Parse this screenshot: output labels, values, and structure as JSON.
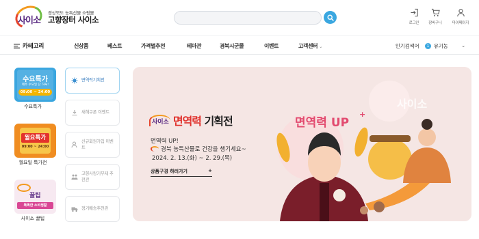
{
  "header": {
    "logo_sub": "경상북도 농특산물 쇼핑몰",
    "logo_main": "고향장터 사이소",
    "logo_word": "사이소",
    "search_placeholder": "",
    "utils": [
      {
        "label": "로그인",
        "icon": "login-icon"
      },
      {
        "label": "장바구니",
        "icon": "cart-icon"
      },
      {
        "label": "마이페이지",
        "icon": "user-icon"
      }
    ]
  },
  "nav": {
    "category_label": "카테고리",
    "items": [
      "신상품",
      "베스트",
      "가격별추천",
      "테마관",
      "경북시군몰",
      "이벤트",
      "고객센터"
    ],
    "popular_label": "인기검색어",
    "popular_rank": "1",
    "popular_term": "유기농"
  },
  "left_promos": [
    {
      "label": "수요특가",
      "badge_title": "수요특가",
      "badge_sub": "매주 수요일 단 하루!",
      "badge_time": "09:00 ~ 24:00"
    },
    {
      "label": "월요일 특가전",
      "badge_title": "월요특가",
      "badge_time": "09:00 ~ 24:00"
    },
    {
      "label": "사이소 꿀팁",
      "badge_title": "꿀팁",
      "badge_sub": "똑똑한 소비생활"
    }
  ],
  "tabs": [
    {
      "label": "면역력기획전",
      "icon": "virus-icon"
    },
    {
      "label": "새해쿠폰 이벤트",
      "icon": "download-icon"
    },
    {
      "label": "신규회원가입 이벤트",
      "icon": "user-plus-icon"
    },
    {
      "label": "고향사랑기부제 추천관",
      "icon": "people-icon"
    },
    {
      "label": "정기배송추천관",
      "icon": "truck-icon"
    }
  ],
  "banner": {
    "logo_word": "사이소",
    "title_accent": "면역력",
    "title_rest": " 기획전",
    "line1": "면역력 UP!",
    "line2": "경북 농특산물로 건강을 챙기세요~",
    "line3": "2024. 2. 13.(화) ~ 2. 29.(목)",
    "cta": "상품구경 하러가기",
    "cta_plus": "+",
    "art_text": "면역력 UP",
    "art_plus": "+",
    "art_watermark": "사이소",
    "colors": {
      "accent": "#e0312c",
      "background": "#f5e6e4"
    }
  }
}
